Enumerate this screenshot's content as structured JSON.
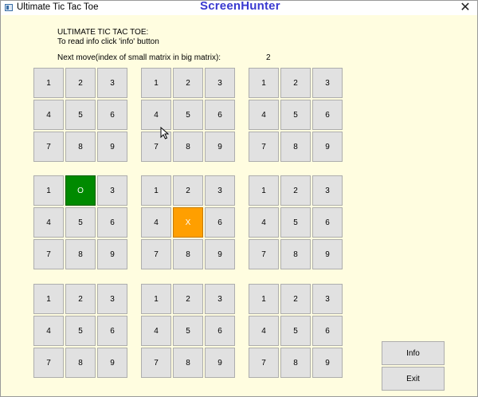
{
  "window": {
    "title": "Ultimate Tic Tac Toe",
    "watermark": "ScreenHunter",
    "close_glyph": "✕"
  },
  "info": {
    "line1": "ULTIMATE TIC TAC TOE:",
    "line2": "To read info click 'info' button",
    "next_move_label": "Next move(index of small matrix in big matrix):",
    "next_move_value": "2"
  },
  "boards": [
    {
      "cells": [
        "1",
        "2",
        "3",
        "4",
        "5",
        "6",
        "7",
        "8",
        "9"
      ]
    },
    {
      "cells": [
        "1",
        "2",
        "3",
        "4",
        "5",
        "6",
        "7",
        "8",
        "9"
      ]
    },
    {
      "cells": [
        "1",
        "2",
        "3",
        "4",
        "5",
        "6",
        "7",
        "8",
        "9"
      ]
    },
    {
      "cells": [
        "1",
        "O",
        "3",
        "4",
        "5",
        "6",
        "7",
        "8",
        "9"
      ]
    },
    {
      "cells": [
        "1",
        "2",
        "3",
        "4",
        "X",
        "6",
        "7",
        "8",
        "9"
      ]
    },
    {
      "cells": [
        "1",
        "2",
        "3",
        "4",
        "5",
        "6",
        "7",
        "8",
        "9"
      ]
    },
    {
      "cells": [
        "1",
        "2",
        "3",
        "4",
        "5",
        "6",
        "7",
        "8",
        "9"
      ]
    },
    {
      "cells": [
        "1",
        "2",
        "3",
        "4",
        "5",
        "6",
        "7",
        "8",
        "9"
      ]
    },
    {
      "cells": [
        "1",
        "2",
        "3",
        "4",
        "5",
        "6",
        "7",
        "8",
        "9"
      ]
    }
  ],
  "board_order": [
    "top-left",
    "top-middle",
    "top-right",
    "middle-left",
    "middle-middle",
    "middle-right",
    "bottom-left",
    "bottom-middle",
    "bottom-right"
  ],
  "colors": {
    "background": "#fffde0",
    "o_mark": "#008a00",
    "x_mark": "#ff9f00",
    "title_watermark": "#3a3ad0"
  },
  "buttons": {
    "info_label": "Info",
    "exit_label": "Exit"
  }
}
